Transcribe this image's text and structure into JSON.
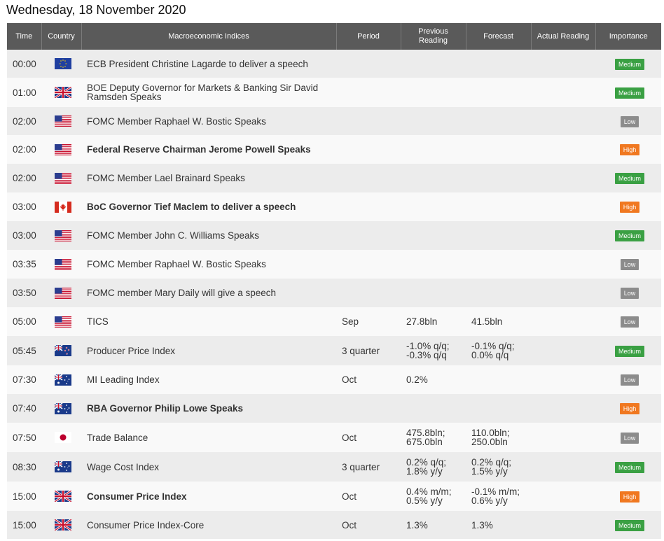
{
  "page": {
    "date_title": "Wednesday, 18 November 2020"
  },
  "colors": {
    "header_bg": "#5a5a5a",
    "medium": "#3aa043",
    "low": "#8c8c8c",
    "high": "#f07820"
  },
  "headers": {
    "time": "Time",
    "country": "Country",
    "indices": "Macroeconomic Indices",
    "period": "Period",
    "previous": "Previous Reading",
    "forecast": "Forecast",
    "actual": "Actual Reading",
    "importance": "Importance"
  },
  "rows": [
    {
      "time": "00:00",
      "flag": "eu-flag-icon",
      "event": "ECB President Christine Lagarde to deliver a speech",
      "bold": false,
      "period": "",
      "previous": "",
      "forecast": "",
      "actual": "",
      "importance": "Medium"
    },
    {
      "time": "01:00",
      "flag": "uk-flag-icon",
      "event": "BOE Deputy Governor for Markets & Banking Sir David Ramsden Speaks",
      "bold": false,
      "period": "",
      "previous": "",
      "forecast": "",
      "actual": "",
      "importance": "Medium"
    },
    {
      "time": "02:00",
      "flag": "us-flag-icon",
      "event": "FOMC Member Raphael W. Bostic Speaks",
      "bold": false,
      "period": "",
      "previous": "",
      "forecast": "",
      "actual": "",
      "importance": "Low"
    },
    {
      "time": "02:00",
      "flag": "us-flag-icon",
      "event": "Federal Reserve Chairman Jerome Powell Speaks",
      "bold": true,
      "period": "",
      "previous": "",
      "forecast": "",
      "actual": "",
      "importance": "High"
    },
    {
      "time": "02:00",
      "flag": "us-flag-icon",
      "event": "FOMC Member Lael Brainard Speaks",
      "bold": false,
      "period": "",
      "previous": "",
      "forecast": "",
      "actual": "",
      "importance": "Medium"
    },
    {
      "time": "03:00",
      "flag": "ca-flag-icon",
      "event": "BoC Governor Tief Maclem to deliver a speech",
      "bold": true,
      "period": "",
      "previous": "",
      "forecast": "",
      "actual": "",
      "importance": "High"
    },
    {
      "time": "03:00",
      "flag": "us-flag-icon",
      "event": "FOMC Member John C. Williams Speaks",
      "bold": false,
      "period": "",
      "previous": "",
      "forecast": "",
      "actual": "",
      "importance": "Medium"
    },
    {
      "time": "03:35",
      "flag": "us-flag-icon",
      "event": "FOMC Member Raphael W. Bostic Speaks",
      "bold": false,
      "period": "",
      "previous": "",
      "forecast": "",
      "actual": "",
      "importance": "Low"
    },
    {
      "time": "03:50",
      "flag": "us-flag-icon",
      "event": "FOMC member Mary Daily will give a speech",
      "bold": false,
      "period": "",
      "previous": "",
      "forecast": "",
      "actual": "",
      "importance": "Low"
    },
    {
      "time": "05:00",
      "flag": "us-flag-icon",
      "event": "TICS",
      "bold": false,
      "period": "Sep",
      "previous": "27.8bln",
      "forecast": "41.5bln",
      "actual": "",
      "importance": "Low"
    },
    {
      "time": "05:45",
      "flag": "nz-flag-icon",
      "event": "Producer Price Index",
      "bold": false,
      "period": "3 quarter",
      "previous": "-1.0% q/q;\n-0.3% q/q",
      "forecast": "-0.1% q/q;\n0.0% q/q",
      "actual": "",
      "importance": "Medium"
    },
    {
      "time": "07:30",
      "flag": "au-flag-icon",
      "event": "MI Leading Index",
      "bold": false,
      "period": "Oct",
      "previous": "0.2%",
      "forecast": "",
      "actual": "",
      "importance": "Low"
    },
    {
      "time": "07:40",
      "flag": "au-flag-icon",
      "event": "RBA Governor Philip Lowe Speaks",
      "bold": true,
      "period": "",
      "previous": "",
      "forecast": "",
      "actual": "",
      "importance": "High"
    },
    {
      "time": "07:50",
      "flag": "jp-flag-icon",
      "event": "Trade Balance",
      "bold": false,
      "period": "Oct",
      "previous": "475.8bln;\n675.0bln",
      "forecast": "110.0bln;\n250.0bln",
      "actual": "",
      "importance": "Low"
    },
    {
      "time": "08:30",
      "flag": "au-flag-icon",
      "event": "Wage Cost Index",
      "bold": false,
      "period": "3 quarter",
      "previous": "0.2% q/q;\n1.8% y/y",
      "forecast": "0.2% q/q;\n1.5% y/y",
      "actual": "",
      "importance": "Medium"
    },
    {
      "time": "15:00",
      "flag": "uk-flag-icon",
      "event": "Consumer Price Index",
      "bold": true,
      "period": "Oct",
      "previous": "0.4% m/m;\n0.5% y/y",
      "forecast": "-0.1% m/m;\n0.6% y/y",
      "actual": "",
      "importance": "High"
    },
    {
      "time": "15:00",
      "flag": "uk-flag-icon",
      "event": "Consumer Price Index-Core",
      "bold": false,
      "period": "Oct",
      "previous": "1.3%",
      "forecast": "1.3%",
      "actual": "",
      "importance": "Medium"
    }
  ]
}
